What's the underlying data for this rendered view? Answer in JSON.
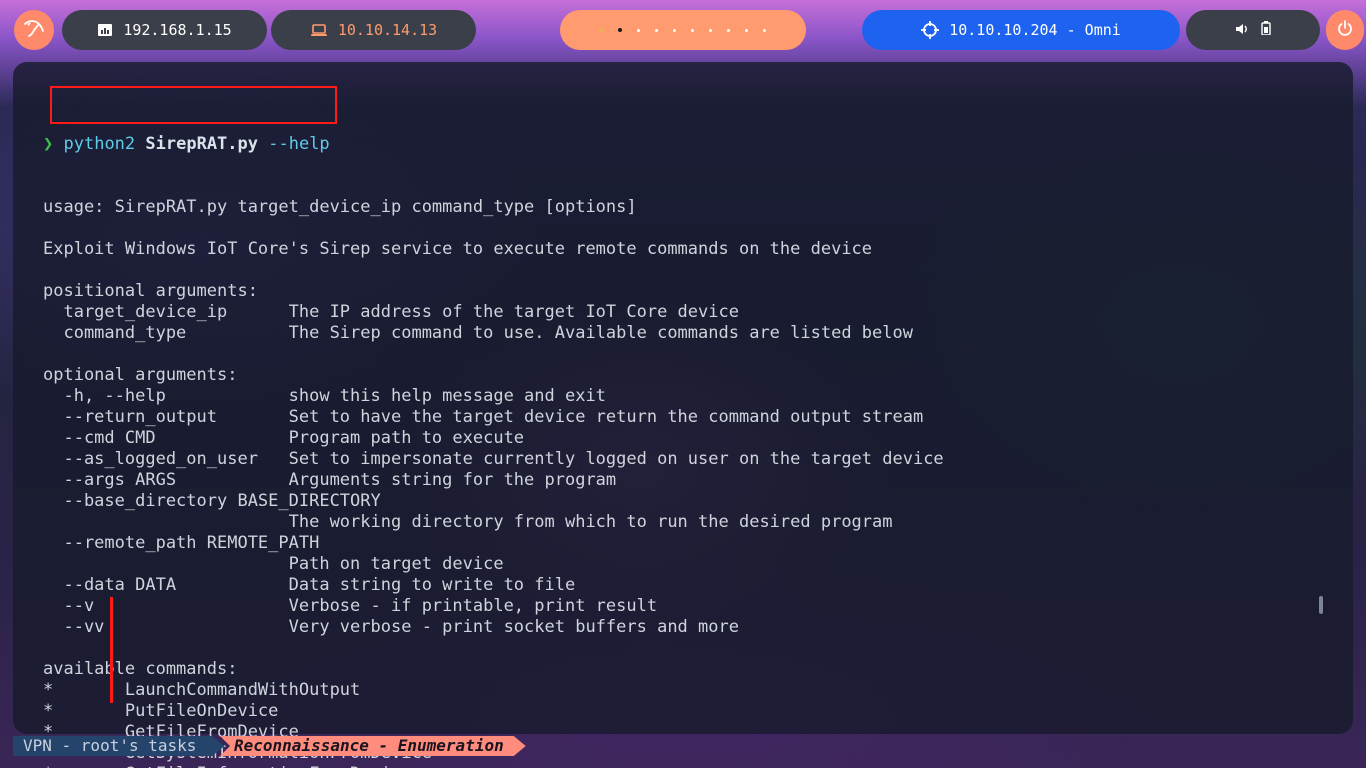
{
  "topbar": {
    "local_ip": "192.168.1.15",
    "vpn_ip": "10.10.14.13",
    "target": "10.10.10.204 - Omni",
    "icons": {
      "launcher": "kali-dragon-icon",
      "local": "ethernet-icon",
      "vpn": "laptop-icon",
      "target": "crosshair-icon",
      "volume": "speaker-icon",
      "battery": "battery-icon",
      "power": "power-icon"
    }
  },
  "colors": {
    "accent_orange": "#ff9b6e",
    "target_blue": "#1e63f0",
    "highlight_red": "#ff1a1a",
    "prompt_green": "#3fbf4a"
  },
  "terminal": {
    "prompt_symbol": "❯",
    "command": {
      "interpreter": "python2",
      "script": "SirepRAT.py",
      "args": "--help"
    },
    "lines": [
      "usage: SirepRAT.py target_device_ip command_type [options]",
      "",
      "Exploit Windows IoT Core's Sirep service to execute remote commands on the device",
      "",
      "positional arguments:",
      "  target_device_ip      The IP address of the target IoT Core device",
      "  command_type          The Sirep command to use. Available commands are listed below",
      "",
      "optional arguments:",
      "  -h, --help            show this help message and exit",
      "  --return_output       Set to have the target device return the command output stream",
      "  --cmd CMD             Program path to execute",
      "  --as_logged_on_user   Set to impersonate currently logged on user on the target device",
      "  --args ARGS           Arguments string for the program",
      "  --base_directory BASE_DIRECTORY",
      "                        The working directory from which to run the desired program",
      "  --remote_path REMOTE_PATH",
      "                        Path on target device",
      "  --data DATA           Data string to write to file",
      "  --v                   Verbose - if printable, print result",
      "  --vv                  Very verbose - print socket buffers and more",
      "",
      "available commands:",
      "*       LaunchCommandWithOutput",
      "*       PutFileOnDevice",
      "*       GetFileFromDevice",
      "*       GetSystemInformationFromDevice",
      "*       GetFileInformationFromDevice"
    ]
  },
  "statusbar": {
    "session": "VPN - root's tasks",
    "window": "Reconnaissance - Enumeration"
  }
}
